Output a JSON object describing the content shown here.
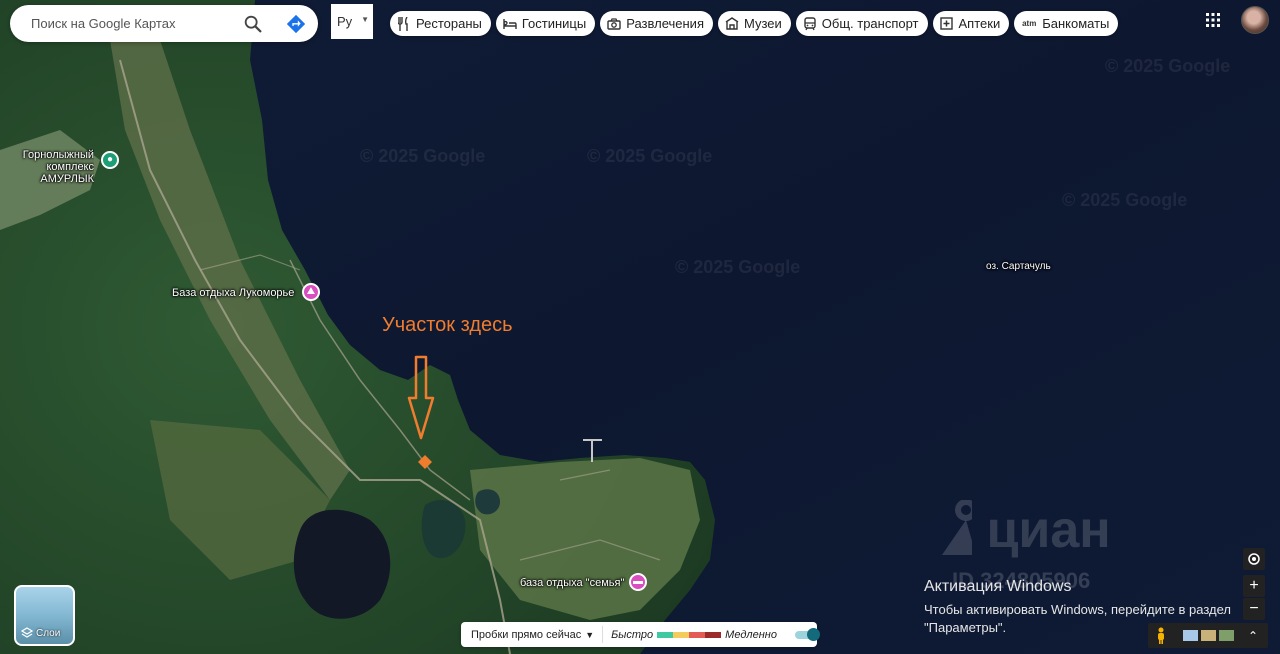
{
  "search": {
    "placeholder": "Поиск на Google Картах",
    "search_icon": "search-icon",
    "directions_icon": "directions-icon"
  },
  "layer_select": {
    "label": "Ру"
  },
  "chips": [
    {
      "label": "Рестораны",
      "icon": "restaurant-icon"
    },
    {
      "label": "Гостиницы",
      "icon": "hotel-icon"
    },
    {
      "label": "Развлечения",
      "icon": "camera-icon"
    },
    {
      "label": "Музеи",
      "icon": "museum-icon"
    },
    {
      "label": "Общ. транспорт",
      "icon": "transit-icon"
    },
    {
      "label": "Аптеки",
      "icon": "pharmacy-icon"
    },
    {
      "label": "Банкоматы",
      "icon": "atm-icon",
      "icon_text": "atm"
    }
  ],
  "map": {
    "watermark": "© 2025 Google",
    "places": [
      {
        "name": "Горнолыжный\nкомплекс АМУРЛЫК",
        "type": "ski",
        "color": "#1e9e75"
      },
      {
        "name": "База отдыха Лукоморье",
        "type": "resort",
        "color": "#d94fc0"
      },
      {
        "name": "база отдыха \"семья\"",
        "type": "hotel",
        "color": "#d94fc0"
      },
      {
        "name": "оз. Сартачуль",
        "type": "lake"
      }
    ],
    "annotation": {
      "text": "Участок здесь",
      "color": "#f07c2e"
    }
  },
  "layers_button": {
    "label": "Слои"
  },
  "traffic": {
    "label": "Пробки прямо сейчас",
    "fast": "Быстро",
    "slow": "Медленно",
    "colors": [
      "#3fc9a3",
      "#f4cc5b",
      "#e35b55",
      "#9b2a2a"
    ]
  },
  "overlay": {
    "brand": "циан",
    "listing_id": "ID 324805906",
    "activation_title": "Активация Windows",
    "activation_text": "Чтобы активировать Windows, перейдите в раздел",
    "activation_text2": "\"Параметры\"."
  },
  "colors": {
    "water": "#0e1a33",
    "forest": "#264a2c",
    "meadow": "#4d6b3e"
  }
}
